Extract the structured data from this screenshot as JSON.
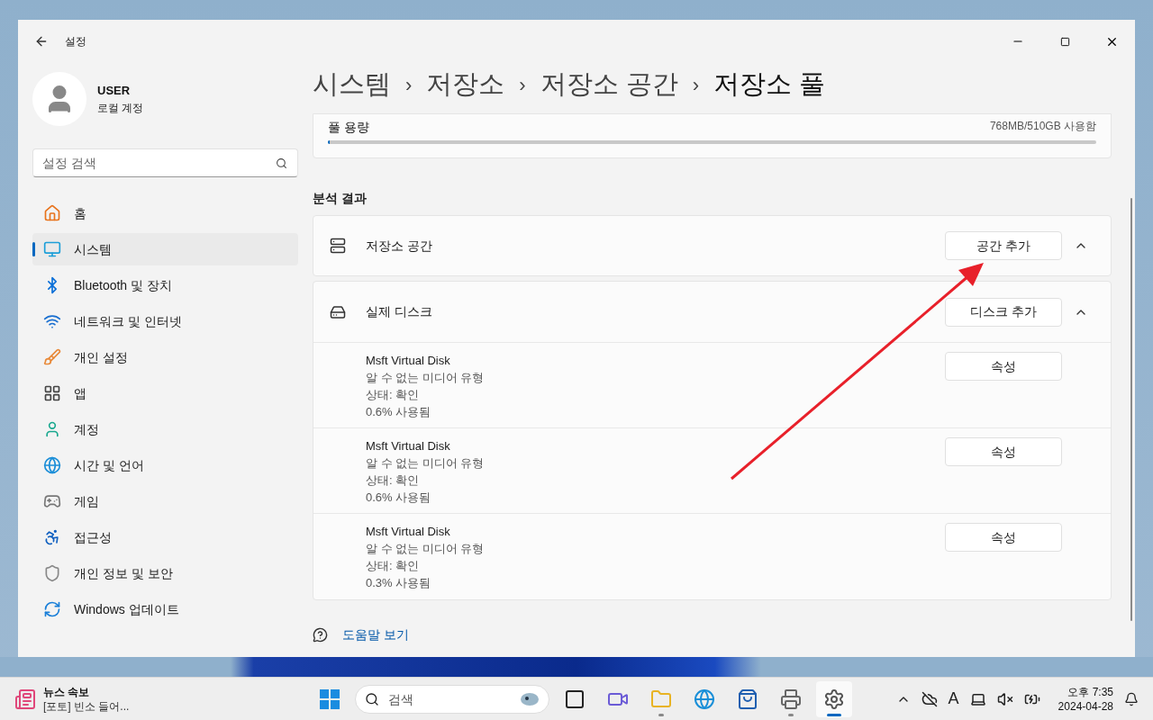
{
  "window": {
    "title": "설정"
  },
  "user": {
    "name": "USER",
    "account": "로컬 계정"
  },
  "search": {
    "placeholder": "설정 검색"
  },
  "sidebar": {
    "items": [
      {
        "label": "홈",
        "selected": false
      },
      {
        "label": "시스템",
        "selected": true
      },
      {
        "label": "Bluetooth 및 장치",
        "selected": false
      },
      {
        "label": "네트워크 및 인터넷",
        "selected": false
      },
      {
        "label": "개인 설정",
        "selected": false
      },
      {
        "label": "앱",
        "selected": false
      },
      {
        "label": "계정",
        "selected": false
      },
      {
        "label": "시간 및 언어",
        "selected": false
      },
      {
        "label": "게임",
        "selected": false
      },
      {
        "label": "접근성",
        "selected": false
      },
      {
        "label": "개인 정보 및 보안",
        "selected": false
      },
      {
        "label": "Windows 업데이트",
        "selected": false
      }
    ]
  },
  "breadcrumb": [
    "시스템",
    "저장소",
    "저장소 공간",
    "저장소 풀"
  ],
  "separator": "›",
  "pool": {
    "label": "풀 용량",
    "usage": "768MB/510GB 사용함",
    "level": 0.0015
  },
  "section_title": "분석 결과",
  "storage_space": {
    "label": "저장소 공간",
    "button": "공간 추가",
    "expanded": true
  },
  "physical_disks": {
    "label": "실제 디스크",
    "button": "디스크 추가",
    "expanded": true,
    "disks": [
      {
        "name": "Msft Virtual Disk",
        "media": "알 수 없는 미디어 유형",
        "status": "상태: 확인",
        "used": "0.6% 사용됨",
        "button": "속성"
      },
      {
        "name": "Msft Virtual Disk",
        "media": "알 수 없는 미디어 유형",
        "status": "상태: 확인",
        "used": "0.6% 사용됨",
        "button": "속성"
      },
      {
        "name": "Msft Virtual Disk",
        "media": "알 수 없는 미디어 유형",
        "status": "상태: 확인",
        "used": "0.3% 사용됨",
        "button": "속성"
      }
    ]
  },
  "help_link": "도움말 보기",
  "taskbar": {
    "news": {
      "title": "뉴스 속보",
      "headline": "[포토] 빈소 들어..."
    },
    "search_placeholder": "검색",
    "apps": [
      {
        "running": false,
        "selected": false
      },
      {
        "running": false,
        "selected": false
      },
      {
        "running": true,
        "selected": false
      },
      {
        "running": false,
        "selected": false
      },
      {
        "running": false,
        "selected": false
      },
      {
        "running": true,
        "selected": false
      },
      {
        "running": true,
        "selected": true
      }
    ],
    "ime": "A",
    "time": "오후 7:35",
    "date": "2024-04-28"
  }
}
